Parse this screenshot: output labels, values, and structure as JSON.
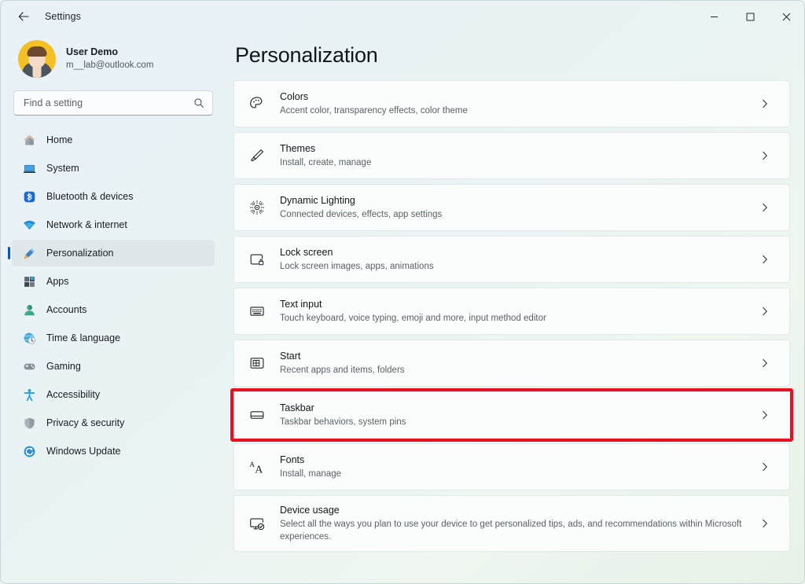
{
  "window": {
    "title": "Settings",
    "back_icon": "back-arrow-icon",
    "controls": [
      {
        "name": "minimize-button",
        "glyph": "‒"
      },
      {
        "name": "maximize-button",
        "glyph": "□"
      },
      {
        "name": "close-button",
        "glyph": "✕"
      }
    ]
  },
  "profile": {
    "name": "User Demo",
    "email": "m__lab@outlook.com",
    "avatar_icon": "user-avatar"
  },
  "search": {
    "placeholder": "Find a setting",
    "value": "",
    "icon": "search-icon"
  },
  "sidebar": {
    "items": [
      {
        "label": "Home",
        "icon": "home-icon",
        "selected": false
      },
      {
        "label": "System",
        "icon": "system-icon",
        "selected": false
      },
      {
        "label": "Bluetooth & devices",
        "icon": "bluetooth-icon",
        "selected": false
      },
      {
        "label": "Network & internet",
        "icon": "wifi-icon",
        "selected": false
      },
      {
        "label": "Personalization",
        "icon": "paintbrush-icon",
        "selected": true
      },
      {
        "label": "Apps",
        "icon": "apps-icon",
        "selected": false
      },
      {
        "label": "Accounts",
        "icon": "account-icon",
        "selected": false
      },
      {
        "label": "Time & language",
        "icon": "clock-globe-icon",
        "selected": false
      },
      {
        "label": "Gaming",
        "icon": "gamepad-icon",
        "selected": false
      },
      {
        "label": "Accessibility",
        "icon": "accessibility-icon",
        "selected": false
      },
      {
        "label": "Privacy & security",
        "icon": "shield-icon",
        "selected": false
      },
      {
        "label": "Windows Update",
        "icon": "update-icon",
        "selected": false
      }
    ]
  },
  "main": {
    "page_title": "Personalization",
    "cards": [
      {
        "title": "Colors",
        "subtitle": "Accent color, transparency effects, color theme",
        "icon": "palette-icon",
        "highlighted": false
      },
      {
        "title": "Themes",
        "subtitle": "Install, create, manage",
        "icon": "paintbrush-icon",
        "highlighted": false
      },
      {
        "title": "Dynamic Lighting",
        "subtitle": "Connected devices, effects, app settings",
        "icon": "lighting-burst-icon",
        "highlighted": false
      },
      {
        "title": "Lock screen",
        "subtitle": "Lock screen images, apps, animations",
        "icon": "lock-screen-icon",
        "highlighted": false
      },
      {
        "title": "Text input",
        "subtitle": "Touch keyboard, voice typing, emoji and more, input method editor",
        "icon": "keyboard-icon",
        "highlighted": false
      },
      {
        "title": "Start",
        "subtitle": "Recent apps and items, folders",
        "icon": "start-grid-icon",
        "highlighted": false
      },
      {
        "title": "Taskbar",
        "subtitle": "Taskbar behaviors, system pins",
        "icon": "taskbar-icon",
        "highlighted": true
      },
      {
        "title": "Fonts",
        "subtitle": "Install, manage",
        "icon": "fonts-aa-icon",
        "highlighted": false
      },
      {
        "title": "Device usage",
        "subtitle": "Select all the ways you plan to use your device to get personalized tips, ads, and recommendations within Microsoft experiences.",
        "icon": "device-usage-icon",
        "highlighted": false
      }
    ],
    "chevron_icon": "chevron-right-icon"
  },
  "colors": {
    "highlight": "#e81123",
    "accent": "#0f57a5",
    "card_bg": "#fbfcfc",
    "selected_nav_bg": "#dfe7eb"
  }
}
